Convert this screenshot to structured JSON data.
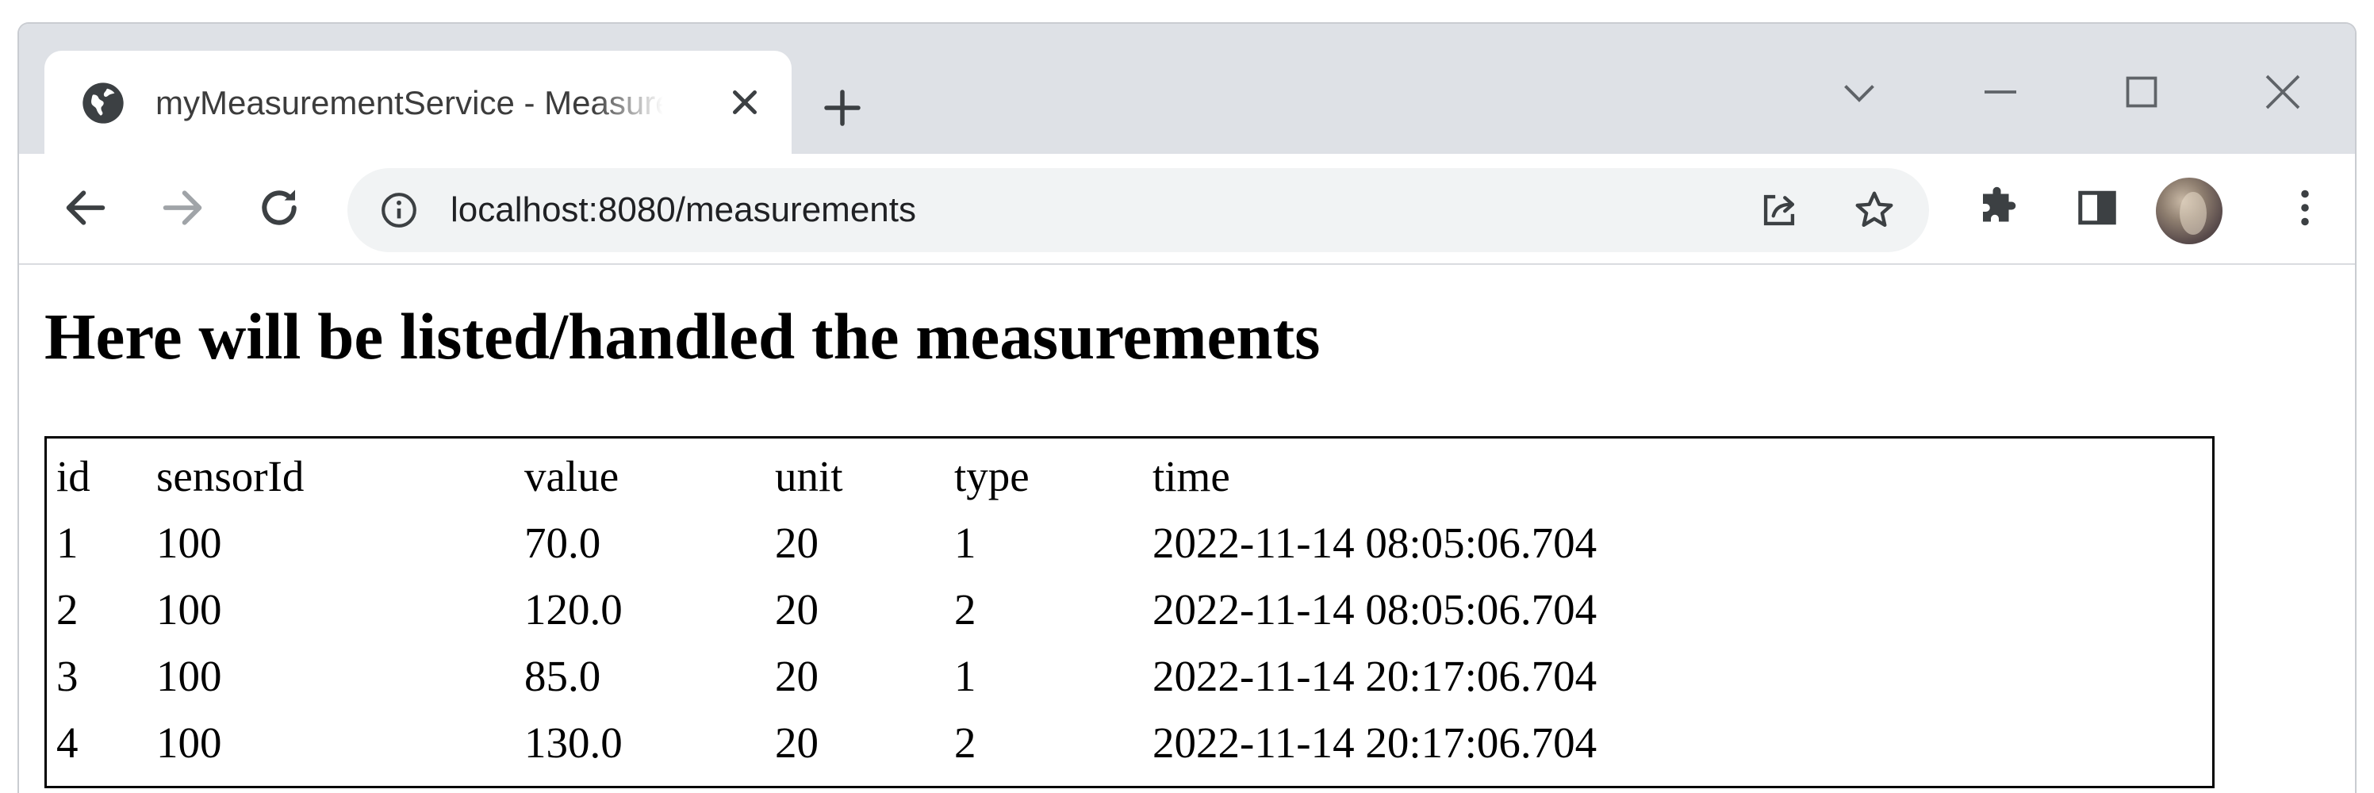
{
  "browser": {
    "tab": {
      "title": "myMeasurementService - Measurements"
    },
    "address": {
      "url": "localhost:8080/measurements"
    }
  },
  "page": {
    "title": "Here will be listed/handled the measurements",
    "table": {
      "columns": [
        "id",
        "sensorId",
        "value",
        "unit",
        "type",
        "time"
      ],
      "rows": [
        [
          "1",
          "100",
          "70.0",
          "20",
          "1",
          "2022-11-14 08:05:06.704"
        ],
        [
          "2",
          "100",
          "120.0",
          "20",
          "2",
          "2022-11-14 08:05:06.704"
        ],
        [
          "3",
          "100",
          "85.0",
          "20",
          "1",
          "2022-11-14 20:17:06.704"
        ],
        [
          "4",
          "100",
          "130.0",
          "20",
          "2",
          "2022-11-14 20:17:06.704"
        ]
      ]
    }
  },
  "colors": {
    "tabstrip_bg": "#dee1e6",
    "omnibox_bg": "#f1f3f4",
    "icon": "#5f6368",
    "text": "#000000"
  },
  "icons": [
    "globe-icon",
    "close-icon",
    "plus-icon",
    "chevron-down-icon",
    "minimize-icon",
    "maximize-icon",
    "close-window-icon",
    "back-arrow-icon",
    "forward-arrow-icon",
    "reload-icon",
    "info-icon",
    "share-icon",
    "star-icon",
    "puzzle-icon",
    "side-panel-icon",
    "kebab-menu-icon"
  ]
}
